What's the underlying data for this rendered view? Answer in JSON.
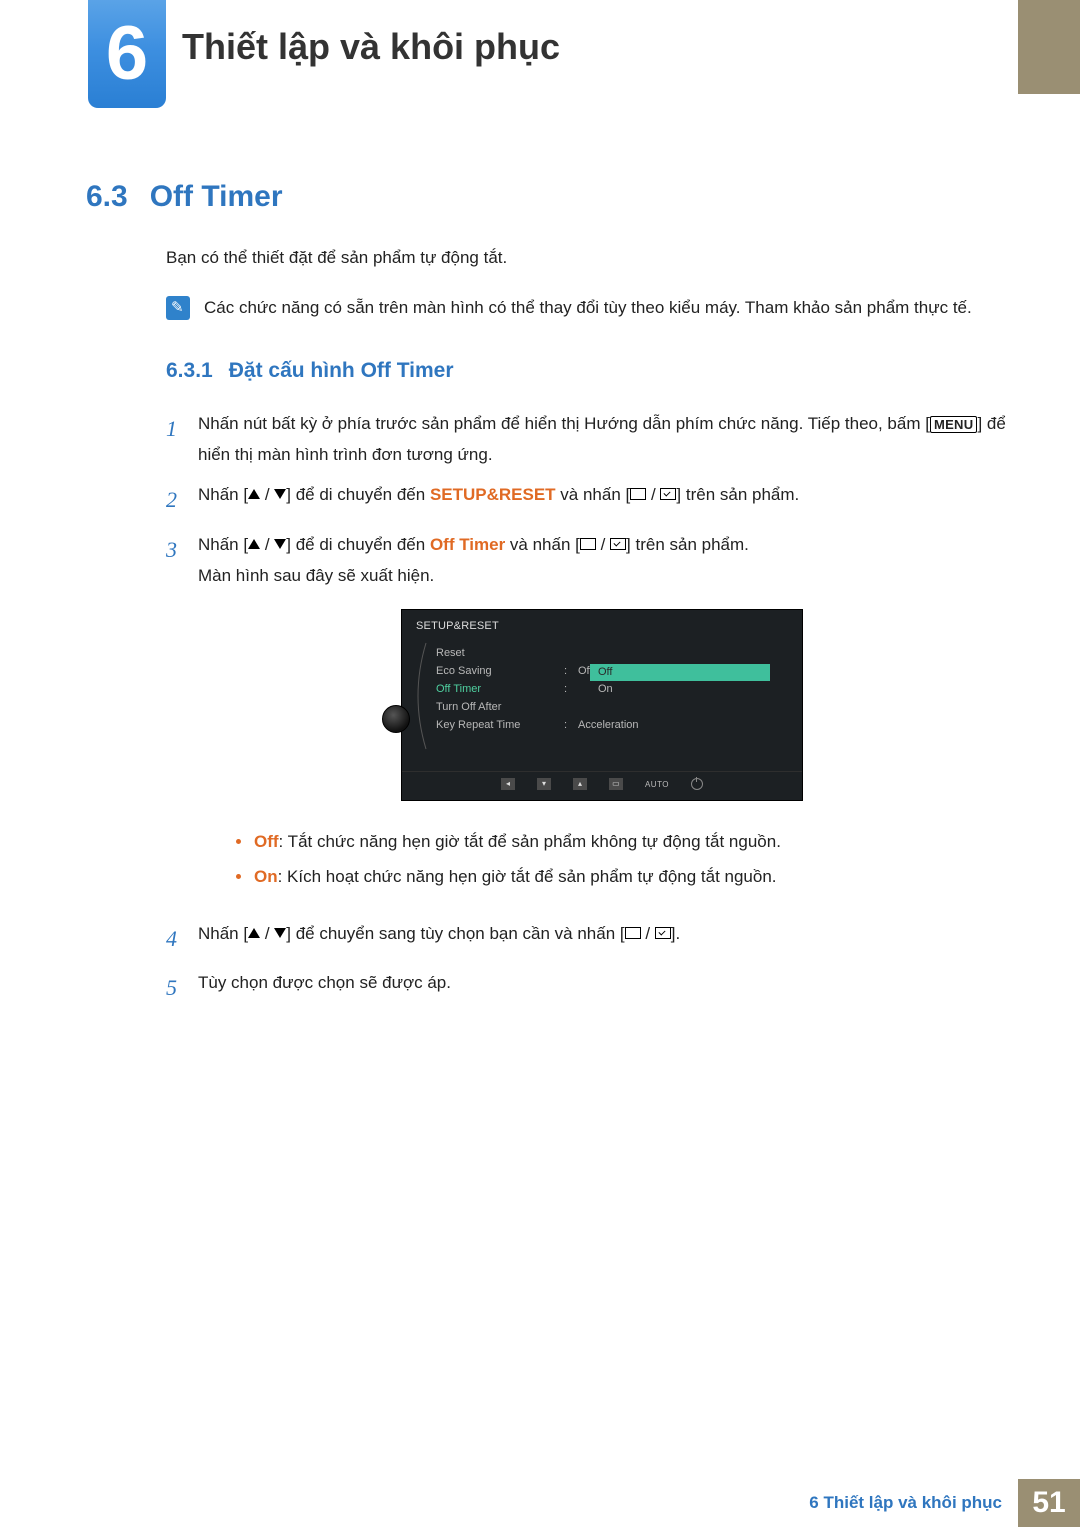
{
  "chapter": {
    "number": "6",
    "title": "Thiết lập và khôi phục"
  },
  "section": {
    "number": "6.3",
    "title": "Off Timer"
  },
  "intro": "Bạn có thể thiết đặt để sản phẩm tự động tắt.",
  "note": "Các chức năng có sẵn trên màn hình có thể thay đổi tùy theo kiểu máy. Tham khảo sản phẩm thực tế.",
  "subsection": {
    "number": "6.3.1",
    "title": "Đặt cấu hình Off Timer"
  },
  "steps": {
    "s1a": "Nhấn nút bất kỳ ở phía trước sản phẩm để hiển thị Hướng dẫn phím chức năng. Tiếp theo, bấm [",
    "s1_menu": "MENU",
    "s1b": "] để hiển thị màn hình trình đơn tương ứng.",
    "s2a": "Nhấn [",
    "s2b": "] để di chuyển đến ",
    "s2_target": "SETUP&RESET",
    "s2c": " và nhấn [",
    "s2d": "] trên sản phẩm.",
    "s3a": "Nhấn [",
    "s3b": "] để di chuyển đến ",
    "s3_target": "Off Timer",
    "s3c": " và nhấn [",
    "s3d": "] trên sản phẩm.",
    "s3_sub": "Màn hình sau đây sẽ xuất hiện.",
    "s4a": "Nhấn [",
    "s4b": "] để chuyển sang tùy chọn bạn cần và nhấn [",
    "s4c": "].",
    "s5": "Tùy chọn được chọn sẽ được áp."
  },
  "bullets": {
    "off_label": "Off",
    "off_text": ": Tắt chức năng hẹn giờ tắt để sản phẩm không tự động tắt nguồn.",
    "on_label": "On",
    "on_text": ": Kích hoạt chức năng hẹn giờ tắt để sản phẩm tự động tắt nguồn."
  },
  "osd": {
    "header": "SETUP&RESET",
    "rows": [
      {
        "label": "Reset",
        "val": ""
      },
      {
        "label": "Eco Saving",
        "val": "Off"
      },
      {
        "label": "Off Timer",
        "val": "Off",
        "selected": true
      },
      {
        "label": "Turn Off After",
        "val": ""
      },
      {
        "label": "Key Repeat Time",
        "val": "Acceleration"
      }
    ],
    "popup": {
      "opt1": "Off",
      "opt2": "On"
    },
    "footer_auto": "AUTO"
  },
  "footer": {
    "text": "6 Thiết lập và khôi phục",
    "page": "51"
  }
}
